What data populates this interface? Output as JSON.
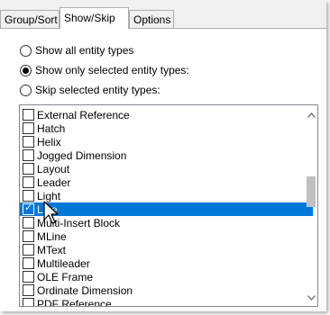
{
  "tabs": [
    {
      "label": "Group/Sort"
    },
    {
      "label": "Show/Skip"
    },
    {
      "label": "Options"
    }
  ],
  "radios": [
    {
      "label": "Show all entity types",
      "checked": false
    },
    {
      "label": "Show only selected entity types:",
      "checked": true
    },
    {
      "label": "Skip selected entity types:",
      "checked": false
    }
  ],
  "entity_list": {
    "items": [
      {
        "label": "External Reference",
        "checked": false
      },
      {
        "label": "Hatch",
        "checked": false
      },
      {
        "label": "Helix",
        "checked": false
      },
      {
        "label": "Jogged Dimension",
        "checked": false
      },
      {
        "label": "Layout",
        "checked": false
      },
      {
        "label": "Leader",
        "checked": false
      },
      {
        "label": "Light",
        "checked": false
      },
      {
        "label": "Line",
        "checked": true
      },
      {
        "label": "Multi-Insert Block",
        "checked": false
      },
      {
        "label": "MLine",
        "checked": false
      },
      {
        "label": "MText",
        "checked": false
      },
      {
        "label": "Multileader",
        "checked": false
      },
      {
        "label": "OLE Frame",
        "checked": false
      },
      {
        "label": "Ordinate Dimension",
        "checked": false
      },
      {
        "label": "PDF Reference",
        "checked": false
      }
    ],
    "selected_item": "Line",
    "scroll_up_icon": "chevron-up-icon",
    "scroll_down_icon": "chevron-down-icon"
  }
}
